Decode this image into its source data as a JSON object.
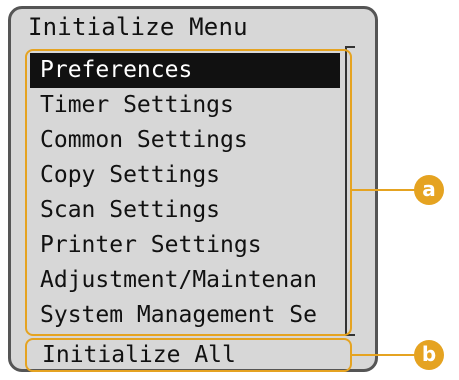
{
  "screen": {
    "title": "Initialize Menu"
  },
  "menu": {
    "items": [
      {
        "label": "Preferences",
        "selected": true
      },
      {
        "label": "Timer Settings"
      },
      {
        "label": "Common Settings"
      },
      {
        "label": "Copy Settings"
      },
      {
        "label": "Scan Settings"
      },
      {
        "label": "Printer Settings"
      },
      {
        "label": "Adjustment/Maintenan"
      },
      {
        "label": "System Management Se"
      }
    ]
  },
  "bottom": {
    "label": "Initialize All"
  },
  "callouts": {
    "a": "a",
    "b": "b"
  },
  "colors": {
    "accent": "#e5a321",
    "panel_bg": "#d7d7d7",
    "selected_bg": "#111111"
  }
}
